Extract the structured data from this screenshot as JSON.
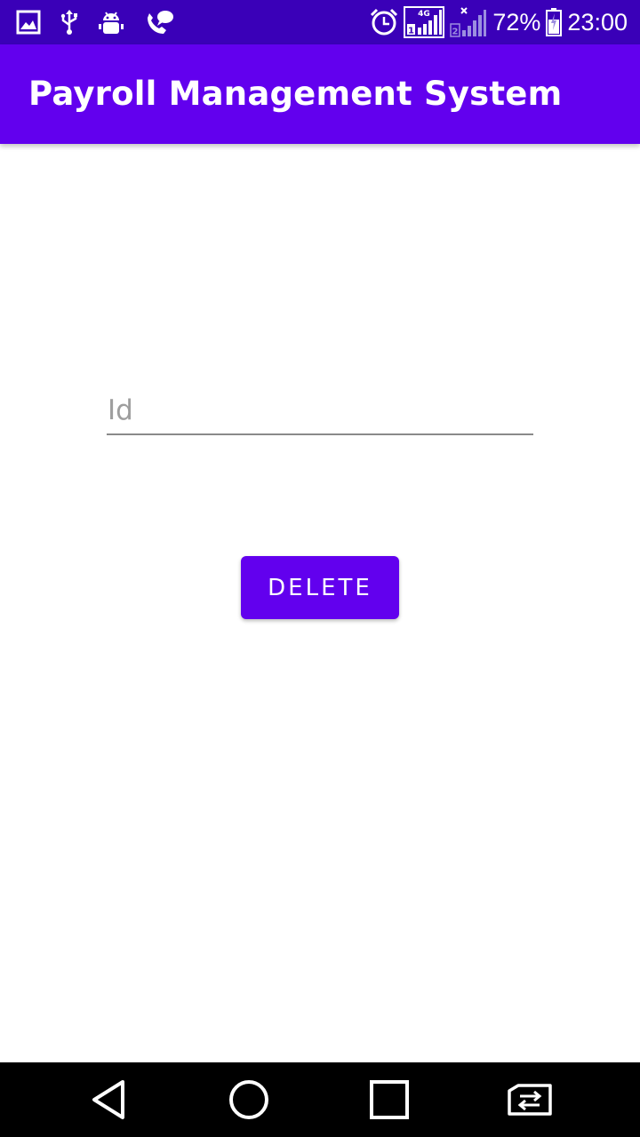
{
  "status_bar": {
    "battery_percent": "72%",
    "time": "23:00",
    "network_type": "4G",
    "sim1_label": "1",
    "sim2_label": "2",
    "icons": {
      "left": [
        "gallery-icon",
        "usb-icon",
        "android-debug-icon",
        "call-chat-icon"
      ],
      "right": [
        "alarm-icon",
        "signal-sim1-icon",
        "signal-sim2-icon",
        "battery-charging-icon"
      ]
    }
  },
  "app_bar": {
    "title": "Payroll Management System"
  },
  "form": {
    "id_field": {
      "placeholder": "Id",
      "value": ""
    },
    "delete_button_label": "DELETE"
  },
  "nav_bar": {
    "icons": [
      "back-icon",
      "home-icon",
      "recents-icon",
      "switch-sim-icon"
    ]
  },
  "colors": {
    "status_bar": "#3a00b8",
    "primary": "#6200ee",
    "nav_bar": "#000000",
    "background": "#ffffff"
  }
}
